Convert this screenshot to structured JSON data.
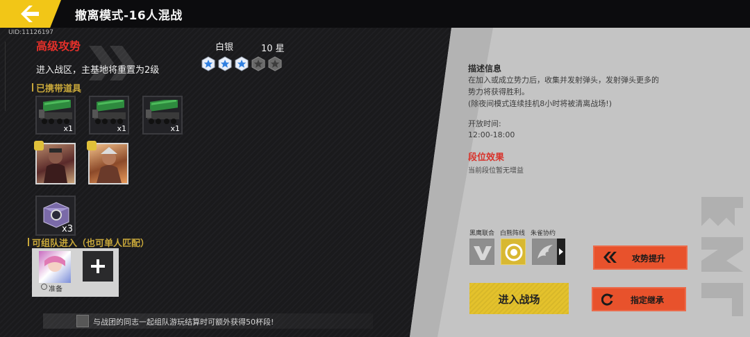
{
  "header": {
    "title": "撤离模式-16人混战"
  },
  "uid": "UID:11126197",
  "left": {
    "offensive_title": "高级攻势",
    "warning": "进入战区，主基地将重置为2级",
    "rank": {
      "name": "白银",
      "stars_text": "10 星",
      "stars_filled": 3,
      "stars_total": 5
    },
    "carried_items_label": "已携带道具",
    "vehicles": [
      {
        "qty": "x1"
      },
      {
        "qty": "x1"
      },
      {
        "qty": "x1"
      }
    ],
    "box_item": {
      "qty": "x3"
    },
    "team_label": "可组队进入（也可单人匹配）",
    "team_member": {
      "status": "准备"
    },
    "tip": "与战团的同志一起组队游玩结算时可额外获得50杯段!"
  },
  "right": {
    "desc_title": "描述信息",
    "desc_body": "在加入或成立势力后，收集并发射弹头，发射弹头更多的\n势力将获得胜利。\n(除夜间模式连续挂机8小时将被清离战场!)",
    "open_label": "开放时间:",
    "open_value": "12:00-18:00",
    "effect_title": "段位效果",
    "effect_body": "当前段位暂无增益",
    "factions": [
      {
        "name": "黑鹰联合"
      },
      {
        "name": "白熊阵线"
      },
      {
        "name": "朱雀协约"
      }
    ],
    "selected_faction": "白熊阵线",
    "enter_button": "进入战场",
    "upgrade_button": "攻势提升",
    "inherit_button": "指定继承"
  },
  "colors": {
    "accent_yellow": "#e4c22c",
    "accent_red": "#d8322a",
    "accent_orange": "#e8522c",
    "star_blue": "#2f7fe0"
  }
}
